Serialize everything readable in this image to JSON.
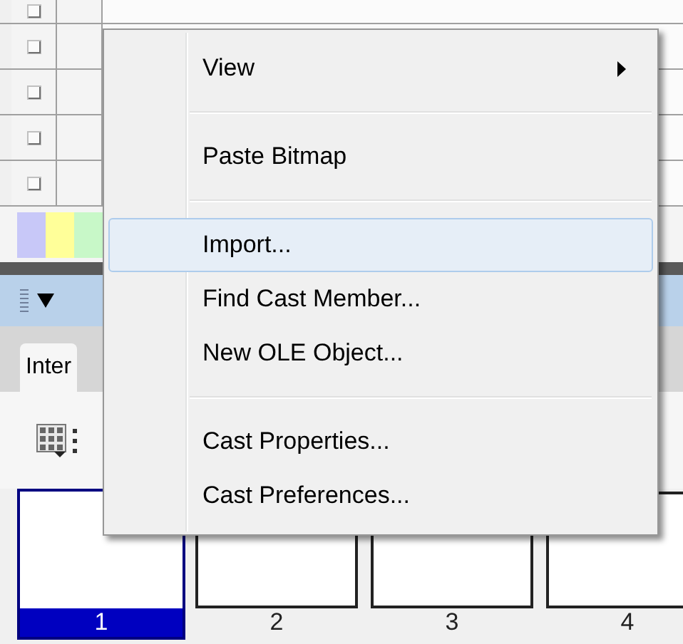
{
  "swatches": [
    {
      "color": "#c8c8f8"
    },
    {
      "color": "#ffff99"
    },
    {
      "color": "#c8f8c8"
    }
  ],
  "panel": {
    "tab": {
      "label": "Inter",
      "selected": true
    }
  },
  "cast_members": [
    {
      "number": "1",
      "selected": true
    },
    {
      "number": "2",
      "selected": false
    },
    {
      "number": "3",
      "selected": false
    },
    {
      "number": "4",
      "selected": false
    }
  ],
  "context_menu": {
    "groups": [
      [
        {
          "kind": "submenu",
          "label": "View",
          "selected": false
        }
      ],
      [
        {
          "kind": "command",
          "label": "Paste Bitmap",
          "selected": false
        }
      ],
      [
        {
          "kind": "command",
          "label": "Import...",
          "selected": true
        },
        {
          "kind": "command",
          "label": "Find Cast Member...",
          "selected": false
        },
        {
          "kind": "command",
          "label": "New OLE Object...",
          "selected": false
        }
      ],
      [
        {
          "kind": "command",
          "label": "Cast Properties...",
          "selected": false
        },
        {
          "kind": "command",
          "label": "Cast Preferences...",
          "selected": false
        }
      ]
    ]
  }
}
